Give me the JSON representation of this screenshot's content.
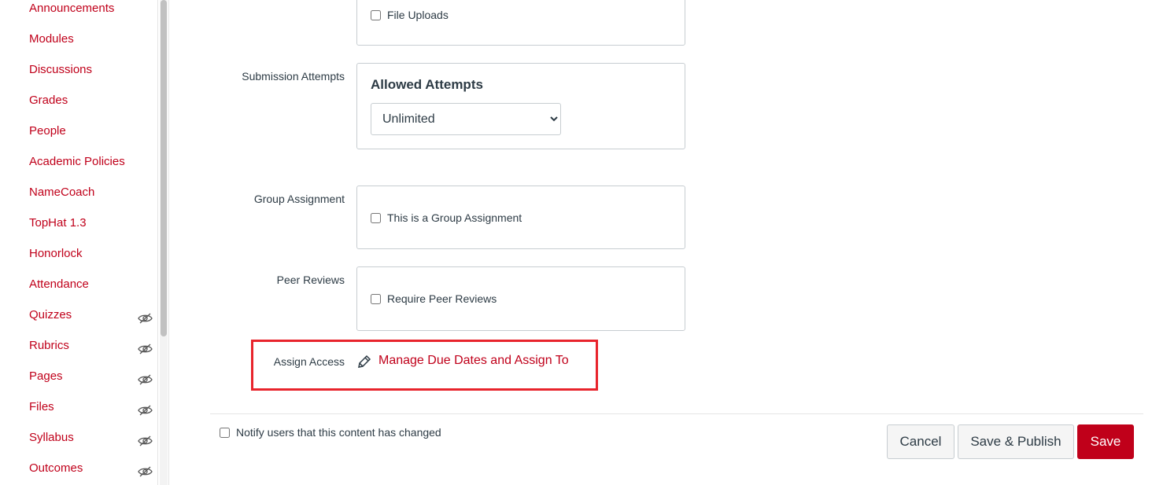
{
  "sidebar": {
    "items": [
      {
        "label": "Announcements",
        "hidden": false
      },
      {
        "label": "Modules",
        "hidden": false
      },
      {
        "label": "Discussions",
        "hidden": false
      },
      {
        "label": "Grades",
        "hidden": false
      },
      {
        "label": "People",
        "hidden": false
      },
      {
        "label": "Academic Policies",
        "hidden": false
      },
      {
        "label": "NameCoach",
        "hidden": false
      },
      {
        "label": "TopHat 1.3",
        "hidden": false
      },
      {
        "label": "Honorlock",
        "hidden": false
      },
      {
        "label": "Attendance",
        "hidden": false
      },
      {
        "label": "Quizzes",
        "hidden": true
      },
      {
        "label": "Rubrics",
        "hidden": true
      },
      {
        "label": "Pages",
        "hidden": true
      },
      {
        "label": "Files",
        "hidden": true
      },
      {
        "label": "Syllabus",
        "hidden": true
      },
      {
        "label": "Outcomes",
        "hidden": true
      }
    ]
  },
  "form": {
    "file_uploads": "File Uploads",
    "submission_attempts_label": "Submission Attempts",
    "allowed_attempts_heading": "Allowed Attempts",
    "allowed_attempts_value": "Unlimited",
    "group_label": "Group Assignment",
    "group_checkbox": "This is a Group Assignment",
    "peer_label": "Peer Reviews",
    "peer_checkbox": "Require Peer Reviews",
    "assign_label": "Assign Access",
    "assign_link": "Manage Due Dates and Assign To"
  },
  "footer": {
    "notify": "Notify users that this content has changed",
    "cancel": "Cancel",
    "save_publish": "Save & Publish",
    "save": "Save"
  },
  "colors": {
    "accent": "#c0001a",
    "highlight": "#e8242c"
  }
}
